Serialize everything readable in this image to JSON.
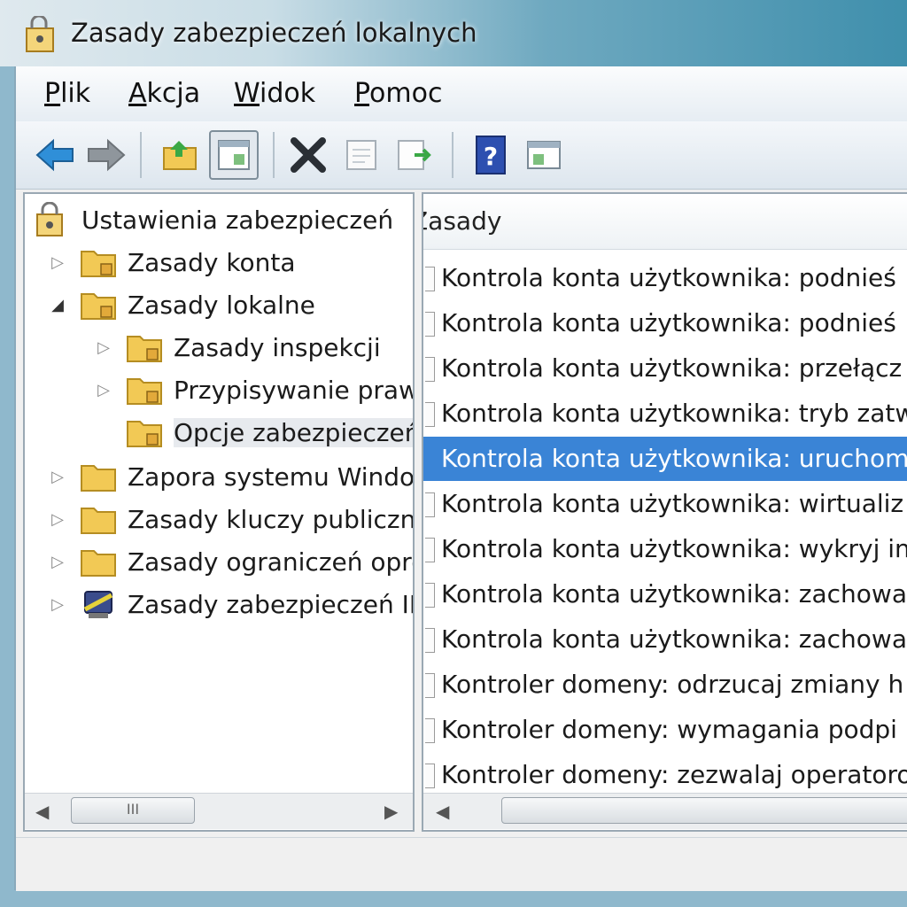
{
  "window": {
    "title": "Zasady zabezpieczeń lokalnych"
  },
  "menu": [
    {
      "label": "Plik"
    },
    {
      "label": "Akcja"
    },
    {
      "label": "Widok"
    },
    {
      "label": "Pomoc"
    }
  ],
  "toolbar": {
    "buttons": [
      "back-arrow-icon",
      "forward-arrow-icon",
      "up-folder-icon",
      "show-hide-tree-icon",
      "delete-icon",
      "properties-icon",
      "export-list-icon",
      "help-icon",
      "show-hide-action-pane-icon"
    ]
  },
  "tree": {
    "root": "Ustawienia zabezpieczeń",
    "items": [
      {
        "label": "Zasady konta",
        "expander": "▷"
      },
      {
        "label": "Zasady lokalne",
        "expander": "◢"
      },
      {
        "label": "Zasady inspekcji",
        "expander": "▷"
      },
      {
        "label": "Przypisywanie praw",
        "expander": "▷"
      },
      {
        "label": "Opcje zabezpieczeń",
        "expander": ""
      },
      {
        "label": "Zapora systemu Windows",
        "expander": "▷"
      },
      {
        "label": "Zasady kluczy publicznych",
        "expander": "▷"
      },
      {
        "label": "Zasady ograniczeń oprogramowania",
        "expander": "▷"
      },
      {
        "label": "Zasady zabezpieczeń IP",
        "expander": "▷"
      }
    ]
  },
  "list": {
    "column_header": "Zasady",
    "rows": [
      "Kontrola konta użytkownika: podnieś",
      "Kontrola konta użytkownika: podnieś",
      "Kontrola konta użytkownika: przełącz",
      "Kontrola konta użytkownika: tryb zatw",
      "Kontrola konta użytkownika: uruchom",
      "Kontrola konta użytkownika: wirtualiz",
      "Kontrola konta użytkownika: wykryj in",
      "Kontrola konta użytkownika: zachowa",
      "Kontrola konta użytkownika: zachowa",
      "Kontroler domeny: odrzucaj zmiany h",
      "Kontroler domeny: wymagania podpi",
      "Kontroler domeny: zezwalaj operatoro"
    ],
    "selected_index": 4
  },
  "scrollbars": {
    "thumb_grip": "III",
    "left_arrow": "◀",
    "right_arrow": "▶"
  },
  "colors": {
    "selection": "#3a84d6",
    "folder": "#f2c955"
  }
}
